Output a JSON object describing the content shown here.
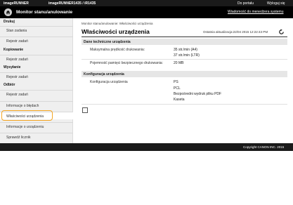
{
  "topbar": {
    "brand": "imageRUNNER",
    "model": "imageRUNNER1435 / iR1435",
    "portal_link": "Do portalu",
    "logout_link": "Wyloguj się"
  },
  "titlebar": {
    "title": "Monitor stanu/anulowanie",
    "message_link": "Wiadomość do menedżera systemu"
  },
  "sidebar": {
    "groups": [
      {
        "heading": "Drukuj",
        "items": [
          "Stan zadania",
          "Rejestr zadań"
        ]
      },
      {
        "heading": "Kopiowanie",
        "items": [
          "Rejestr zadań"
        ]
      },
      {
        "heading": "Wysyłanie",
        "items": [
          "Rejestr zadań"
        ]
      },
      {
        "heading": "Odbiór",
        "items": [
          "Rejestr zadań"
        ]
      }
    ],
    "extra_items": [
      "Informacje o błędach",
      "Właściwości urządzenia",
      "Informacje o urządzeniu",
      "Sprawdź licznik"
    ],
    "active": "Właściwości urządzenia"
  },
  "main": {
    "breadcrumb": "Monitor stanu/anulowanie: Właściwości urządzenia",
    "page_title": "Właściwości urządzenia",
    "last_updated": "Ostatnia aktualizacja:22/04 2015 12:22:43 PM",
    "sections": [
      {
        "title": "Dane techniczne urządzenia",
        "rows": [
          {
            "label": "Maksymalna prędkość drukowania:",
            "values": [
              "35 str./min (A4)",
              "37 str./min (LTR)"
            ]
          },
          {
            "label": "Pojemność pamięci bezpiecznego drukowania:",
            "values": [
              "20 MB"
            ]
          }
        ]
      },
      {
        "title": "Konfiguracja urządzenia",
        "rows": [
          {
            "label": "Konfiguracja urządzenia",
            "values": [
              "PS",
              "PCL",
              "Bezpośredni wydruk pliku PDF",
              "Kaseta"
            ]
          }
        ]
      }
    ]
  },
  "footer": {
    "copyright": "Copyright CANON INC. 2015"
  },
  "colors": {
    "highlight": "#f5a623",
    "bar": "#1a1a1a"
  }
}
